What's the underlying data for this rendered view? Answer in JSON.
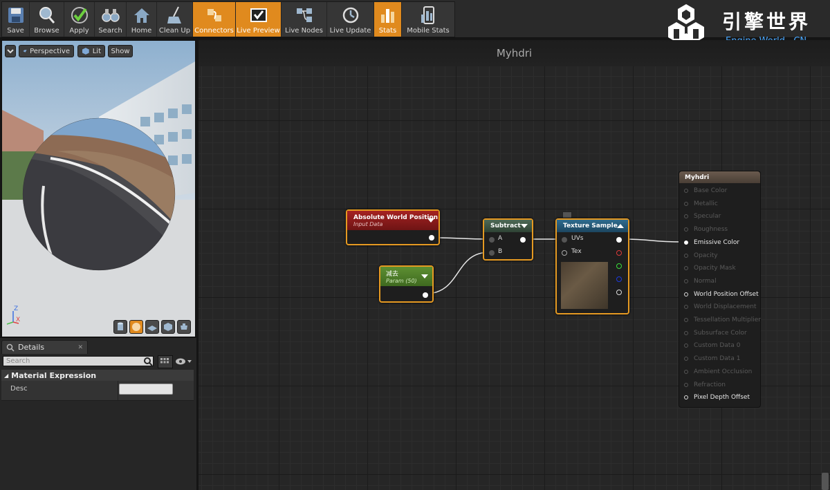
{
  "toolbar": {
    "buttons": [
      {
        "label": "Save",
        "icon": "save-icon",
        "active": false
      },
      {
        "label": "Browse",
        "icon": "browse-icon",
        "active": false
      },
      {
        "label": "Apply",
        "icon": "apply-checkmark-icon",
        "active": false
      },
      {
        "label": "Search",
        "icon": "search-binoculars-icon",
        "active": false
      },
      {
        "label": "Home",
        "icon": "home-icon",
        "active": false
      },
      {
        "label": "Clean Up",
        "icon": "clean-up-broom-icon",
        "active": false
      },
      {
        "label": "Connectors",
        "icon": "connectors-icon",
        "active": true
      },
      {
        "label": "Live Preview",
        "icon": "live-preview-icon",
        "active": true
      },
      {
        "label": "Live Nodes",
        "icon": "live-nodes-icon",
        "active": false
      },
      {
        "label": "Live Update",
        "icon": "live-update-icon",
        "active": false
      },
      {
        "label": "Stats",
        "icon": "stats-icon",
        "active": true
      },
      {
        "label": "Mobile Stats",
        "icon": "mobile-stats-icon",
        "active": false
      }
    ]
  },
  "logo": {
    "cn": "引擎世界",
    "en": "Engine World . CN"
  },
  "viewport": {
    "perspective_label": "Perspective",
    "lit_label": "Lit",
    "show_label": "Show",
    "axis_z": "Z",
    "axis_x": "X"
  },
  "details": {
    "tab_label": "Details",
    "search_placeholder": "Search",
    "section": "Material Expression",
    "desc_label": "Desc",
    "desc_value": ""
  },
  "graph": {
    "title": "Myhdri",
    "nodes": {
      "absolute_world_position": {
        "title": "Absolute World Position",
        "subtitle": "Input Data"
      },
      "subtract": {
        "title": "Subtract",
        "pins": [
          "A",
          "B"
        ]
      },
      "param": {
        "title": "减去",
        "subtitle": "Param (50)"
      },
      "texture_sample": {
        "title": "Texture Sample",
        "pins": [
          "UVs",
          "Tex"
        ]
      }
    },
    "result": {
      "title": "Myhdri",
      "pins": [
        {
          "label": "Base Color",
          "state": "off"
        },
        {
          "label": "Metallic",
          "state": "off"
        },
        {
          "label": "Specular",
          "state": "off"
        },
        {
          "label": "Roughness",
          "state": "off"
        },
        {
          "label": "Emissive Color",
          "state": "on"
        },
        {
          "label": "Opacity",
          "state": "off"
        },
        {
          "label": "Opacity Mask",
          "state": "off"
        },
        {
          "label": "Normal",
          "state": "off"
        },
        {
          "label": "World Position Offset",
          "state": "half"
        },
        {
          "label": "World Displacement",
          "state": "off"
        },
        {
          "label": "Tessellation Multiplier",
          "state": "off"
        },
        {
          "label": "Subsurface Color",
          "state": "off"
        },
        {
          "label": "Custom Data 0",
          "state": "off"
        },
        {
          "label": "Custom Data 1",
          "state": "off"
        },
        {
          "label": "Ambient Occlusion",
          "state": "off"
        },
        {
          "label": "Refraction",
          "state": "off"
        },
        {
          "label": "Pixel Depth Offset",
          "state": "half"
        }
      ]
    }
  },
  "colors": {
    "accent": "#e08a1e",
    "node_border": "#e69a22",
    "awp_header": "#8c1c1c",
    "param_header": "#4e7d2a",
    "tex_header": "#2a5c78",
    "sub_header": "#3e5444"
  }
}
